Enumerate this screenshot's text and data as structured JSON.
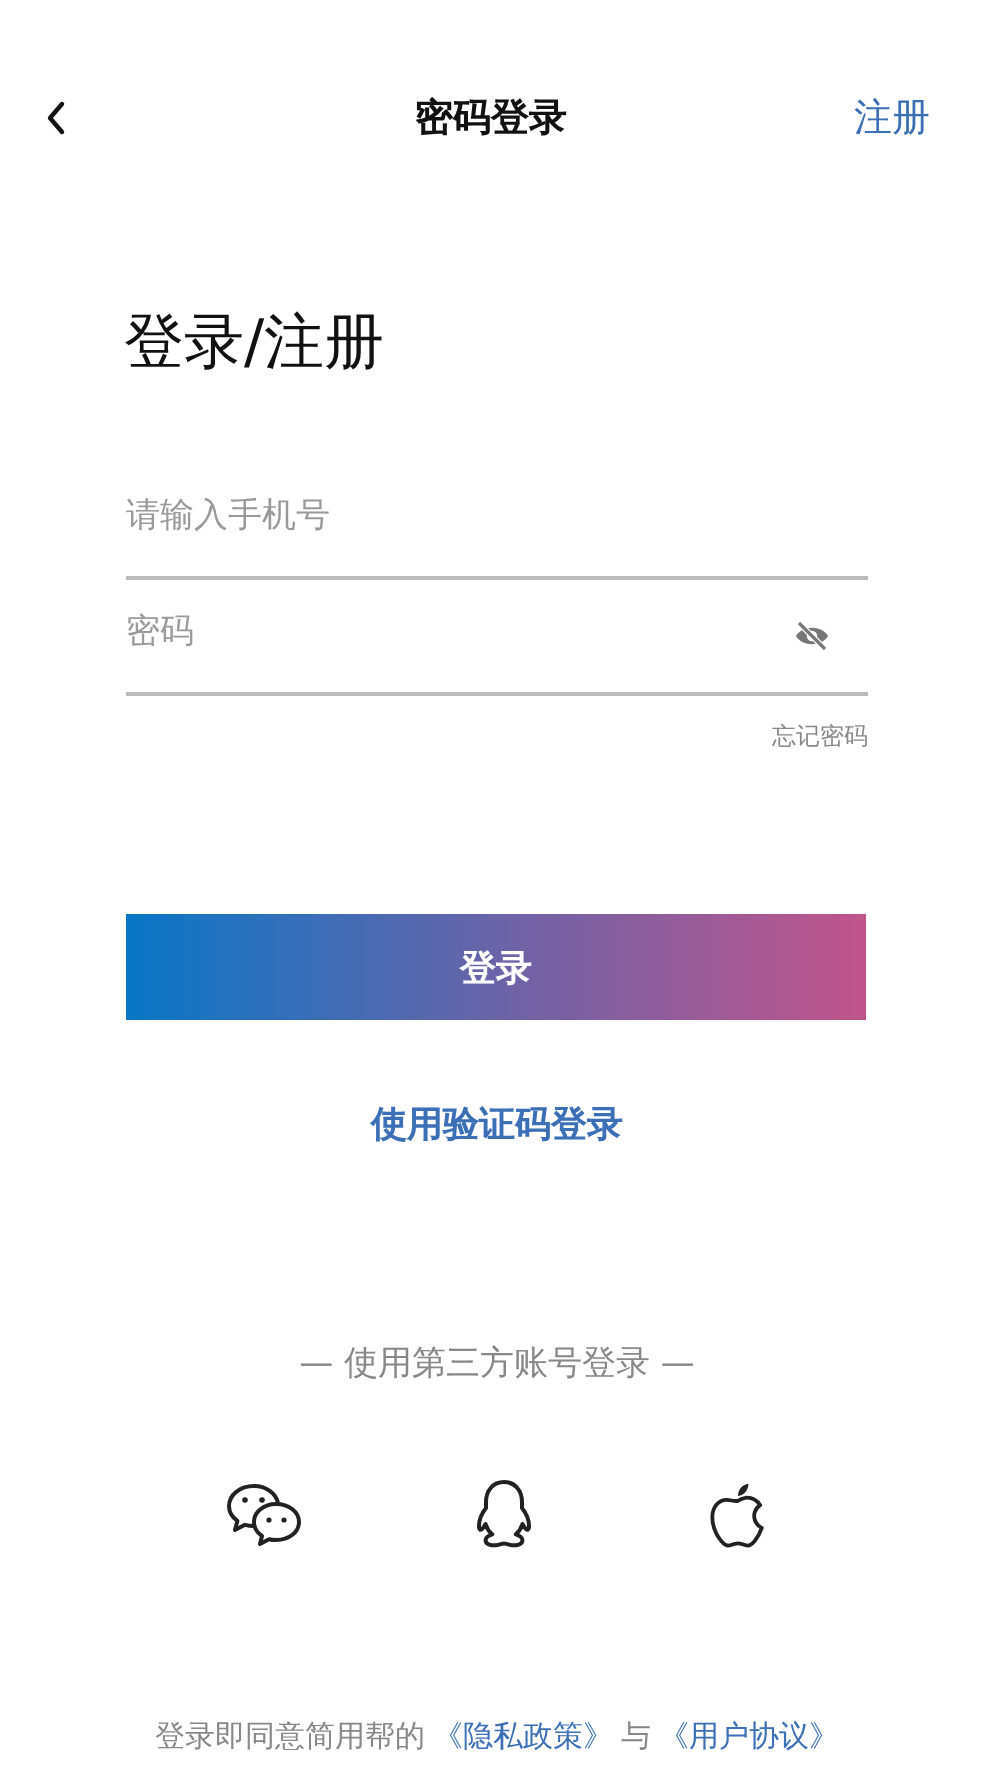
{
  "header": {
    "title": "密码登录",
    "action": "注册"
  },
  "heading": "登录/注册",
  "fields": [
    {
      "kind": "phone",
      "placeholder": "请输入手机号"
    },
    {
      "kind": "password",
      "placeholder": "密码",
      "password_visible": false
    }
  ],
  "forgot_link": "忘记密码",
  "login_button": "登录",
  "sms_login_link": "使用验证码登录",
  "third_party": {
    "label": "— 使用第三方账号登录 —",
    "providers": [
      {
        "kind": "wechat"
      },
      {
        "kind": "qq"
      },
      {
        "kind": "apple"
      }
    ]
  },
  "agreement": [
    {
      "kind": "text",
      "text": "登录即同意简用帮的"
    },
    {
      "kind": "link",
      "text": "《隐私政策》"
    },
    {
      "kind": "text",
      "text": "与"
    },
    {
      "kind": "link",
      "text": "《用户协议》"
    }
  ]
}
